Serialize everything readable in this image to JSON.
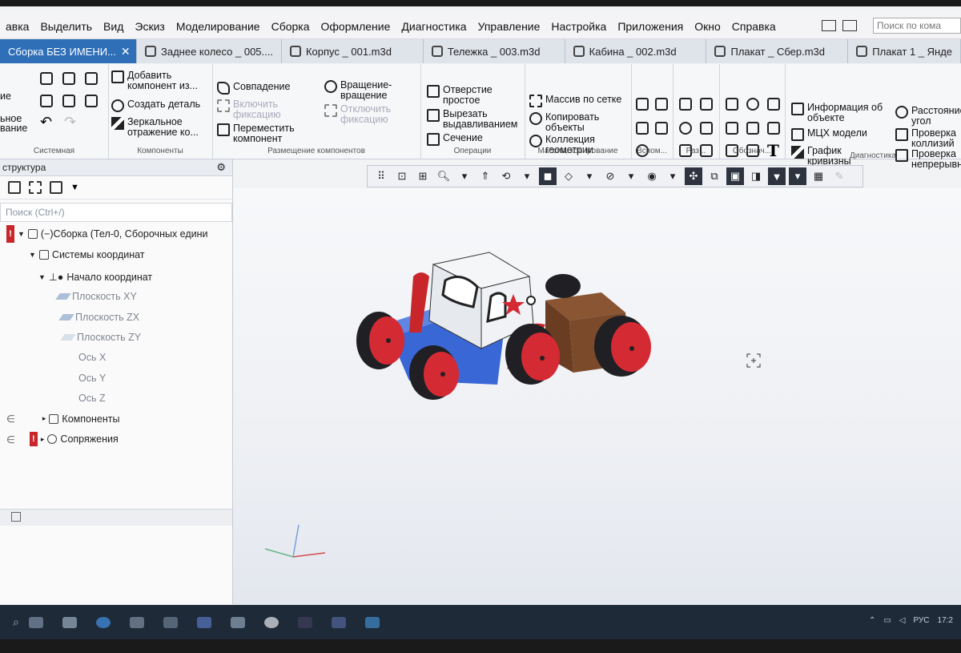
{
  "menu": [
    "авка",
    "Выделить",
    "Вид",
    "Эскиз",
    "Моделирование",
    "Сборка",
    "Оформление",
    "Диагностика",
    "Управление",
    "Настройка",
    "Приложения",
    "Окно",
    "Справка"
  ],
  "tabs": [
    {
      "label": "Сборка БЕЗ ИМЕНИ...",
      "close": "✕",
      "active": true
    },
    {
      "label": "Заднее колесо _ 005...."
    },
    {
      "label": "Корпус _ 001.m3d"
    },
    {
      "label": "Тележка _ 003.m3d"
    },
    {
      "label": "Кабина _ 002.m3d"
    },
    {
      "label": "Плакат _ Сбер.m3d"
    },
    {
      "label": "Плакат 1 _ Янде"
    }
  ],
  "search_placeholder": "Поиск по кома",
  "ribbon": {
    "sys_left": [
      "ие",
      "ьное",
      "вание"
    ],
    "sys_label": "Системная",
    "comp": {
      "add": "Добавить компонент из...",
      "create": "Создать деталь",
      "mirror": "Зеркальное отражение ко...",
      "label": "Компоненты"
    },
    "place": {
      "match": "Совпадение",
      "rotate": "Вращение-вращение",
      "enable_fix": "Включить фиксацию",
      "disable_fix": "Отключить фиксацию",
      "move": "Переместить компонент",
      "label": "Размещение компонентов"
    },
    "ops": {
      "hole": "Отверстие простое",
      "cut": "Вырезать выдавливанием",
      "section": "Сечение",
      "label": "Операции"
    },
    "massive": {
      "grid": "Массив по сетке",
      "copy": "Копировать объекты",
      "collection": "Коллекция геометрии",
      "label": "Массив, копирование"
    },
    "aux_label": "Вспом...",
    "raz_label": "Раз...",
    "oboz_label": "Обознач...",
    "diag": {
      "info": "Информация об объекте",
      "mch": "МЦХ модели",
      "graph": "График кривизны",
      "dist": "Расстояние угол",
      "coll": "Проверка коллизий",
      "cont": "Проверка непрерывн",
      "label": "Диагностика"
    }
  },
  "panel": {
    "title": "структура",
    "search": "Поиск (Ctrl+/)",
    "tree": [
      {
        "label": "(−)Сборка (Тел-0, Сборочных едини"
      },
      {
        "label": "Системы координат"
      },
      {
        "label": "Начало координат"
      },
      {
        "label": "Плоскость XY"
      },
      {
        "label": "Плоскость ZX"
      },
      {
        "label": "Плоскость ZY"
      },
      {
        "label": "Ось X"
      },
      {
        "label": "Ось Y"
      },
      {
        "label": "Ось Z"
      },
      {
        "label": "Компоненты"
      },
      {
        "label": "Сопряжения"
      }
    ]
  },
  "tray": {
    "lang": "РУС",
    "time": "17:2"
  },
  "colors": {
    "accent": "#2f6fb8",
    "body_blue": "#3a67d6",
    "wheel_red": "#d42a34",
    "cargo_brown": "#7b4a2a"
  }
}
